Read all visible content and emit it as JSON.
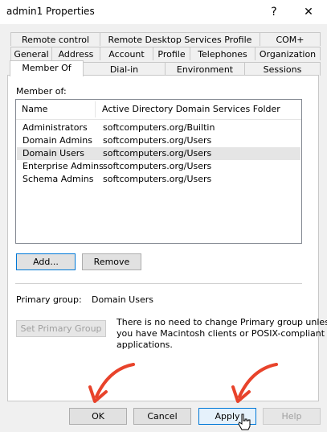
{
  "window": {
    "title": "admin1 Properties",
    "help_glyph": "?",
    "close_glyph": "✕"
  },
  "tabs": {
    "row1": [
      "Remote control",
      "Remote Desktop Services Profile",
      "COM+"
    ],
    "row2": [
      "General",
      "Address",
      "Account",
      "Profile",
      "Telephones",
      "Organization"
    ],
    "row3": [
      "Member Of",
      "Dial-in",
      "Environment",
      "Sessions"
    ],
    "active": "Member Of"
  },
  "member_of": {
    "label": "Member of:",
    "columns": [
      "Name",
      "Active Directory Domain Services Folder"
    ],
    "rows": [
      {
        "name": "Administrators",
        "folder": "softcomputers.org/Builtin"
      },
      {
        "name": "Domain Admins",
        "folder": "softcomputers.org/Users"
      },
      {
        "name": "Domain Users",
        "folder": "softcomputers.org/Users"
      },
      {
        "name": "Enterprise Admins",
        "folder": "softcomputers.org/Users"
      },
      {
        "name": "Schema Admins",
        "folder": "softcomputers.org/Users"
      }
    ],
    "selected_row": "Domain Users"
  },
  "buttons": {
    "add": "Add...",
    "remove": "Remove",
    "set_primary": "Set Primary Group",
    "ok": "OK",
    "cancel": "Cancel",
    "apply": "Apply",
    "help": "Help"
  },
  "primary_group": {
    "label": "Primary group:",
    "value": "Domain Users",
    "note": [
      "There is no need to change Primary group unless",
      "you have Macintosh clients or POSIX-compliant",
      "applications."
    ]
  },
  "colors": {
    "annotation_arrow": "#e8432b",
    "focus_border": "#0078d7",
    "selection": "#e5e5e5"
  }
}
